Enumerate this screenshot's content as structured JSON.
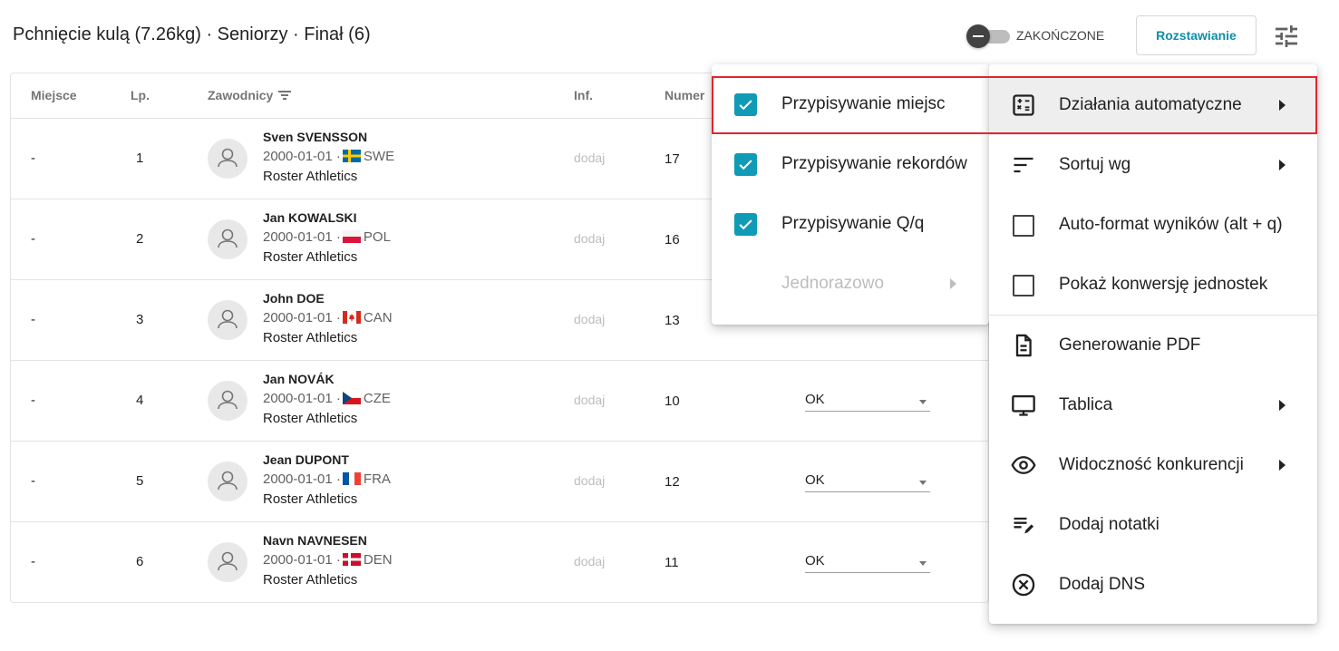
{
  "header": {
    "title": "Pchnięcie kulą (7.26kg) · Seniorzy · Finał (6)",
    "toggle_label": "ZAKOŃCZONE",
    "seeding_button": "Rozstawianie"
  },
  "table": {
    "columns": {
      "place": "Miejsce",
      "lp": "Lp.",
      "athletes": "Zawodnicy",
      "inf": "Inf.",
      "number": "Numer"
    },
    "rows": [
      {
        "place": "-",
        "lp": "1",
        "name": "Sven SVENSSON",
        "dob": "2000-01-01 ·",
        "country": "SWE",
        "club": "Roster Athletics",
        "inf": "dodaj",
        "number": "17",
        "status": ""
      },
      {
        "place": "-",
        "lp": "2",
        "name": "Jan KOWALSKI",
        "dob": "2000-01-01 ·",
        "country": "POL",
        "club": "Roster Athletics",
        "inf": "dodaj",
        "number": "16",
        "status": ""
      },
      {
        "place": "-",
        "lp": "3",
        "name": "John DOE",
        "dob": "2000-01-01 ·",
        "country": "CAN",
        "club": "Roster Athletics",
        "inf": "dodaj",
        "number": "13",
        "status": ""
      },
      {
        "place": "-",
        "lp": "4",
        "name": "Jan NOVÁK",
        "dob": "2000-01-01 ·",
        "country": "CZE",
        "club": "Roster Athletics",
        "inf": "dodaj",
        "number": "10",
        "status": "OK"
      },
      {
        "place": "-",
        "lp": "5",
        "name": "Jean DUPONT",
        "dob": "2000-01-01 ·",
        "country": "FRA",
        "club": "Roster Athletics",
        "inf": "dodaj",
        "number": "12",
        "status": "OK"
      },
      {
        "place": "-",
        "lp": "6",
        "name": "Navn NAVNESEN",
        "dob": "2000-01-01 ·",
        "country": "DEN",
        "club": "Roster Athletics",
        "inf": "dodaj",
        "number": "11",
        "status": "OK"
      }
    ]
  },
  "submenu": {
    "items": [
      {
        "label": "Przypisywanie miejsc",
        "checked": true
      },
      {
        "label": "Przypisywanie rekordów",
        "checked": true
      },
      {
        "label": "Przypisywanie Q/q",
        "checked": true
      },
      {
        "label": "Jednorazowo",
        "disabled": true
      }
    ]
  },
  "menu": {
    "items": [
      {
        "label": "Działania automatyczne",
        "icon": "calculator-icon"
      },
      {
        "label": "Sortuj wg",
        "icon": "sort-icon"
      },
      {
        "label": "Auto-format wyników (alt + q)",
        "icon": "checkbox-icon"
      },
      {
        "label": "Pokaż konwersję jednostek",
        "icon": "checkbox-icon"
      },
      {
        "label": "Generowanie PDF",
        "icon": "document-icon"
      },
      {
        "label": "Tablica",
        "icon": "monitor-icon"
      },
      {
        "label": "Widoczność konkurencji",
        "icon": "eye-icon"
      },
      {
        "label": "Dodaj notatki",
        "icon": "edit-notes-icon"
      },
      {
        "label": "Dodaj DNS",
        "icon": "cancel-circle-icon"
      }
    ]
  },
  "colors": {
    "accent": "#0f9bb5",
    "highlight": "#e0262c"
  }
}
